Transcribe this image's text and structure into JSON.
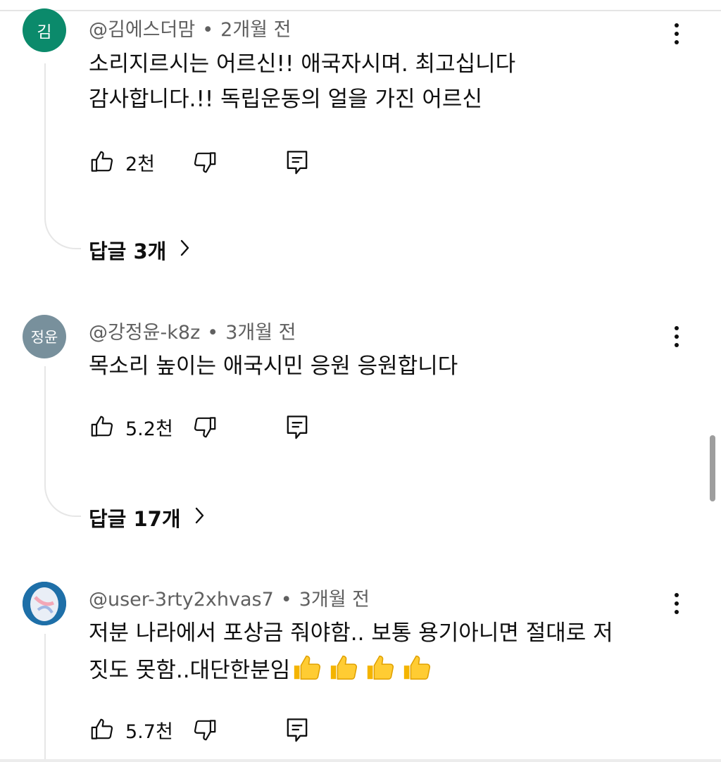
{
  "comments": [
    {
      "avatar_text": "김",
      "avatar_color": "#0b8a6b",
      "author": "@김에스더맘",
      "time": "2개월 전",
      "lines": [
        "소리지르시는 어르신!!   애국자시며. 최고십니다",
        "감사합니다.!!   독립운동의 얼을 가진 어르신"
      ],
      "likes": "2천",
      "replies_label": "답글 3개"
    },
    {
      "avatar_text": "정윤",
      "avatar_color": "#78909c",
      "author": "@강정윤-k8z",
      "time": "3개월 전",
      "lines": [
        "목소리 높이는 애국시민 응원 응원합니다"
      ],
      "likes": "5.2천",
      "replies_label": "답글 17개"
    },
    {
      "avatar_text": "",
      "avatar_color": "#1e6fa8",
      "author": "@user-3rty2xhvas7",
      "time": "3개월 전",
      "lines": [
        "저분 나라에서 포상금 줘야함.. 보통 용기아니면 절대로 저",
        "짓도 못함..대단한분임"
      ],
      "emoji": "thumbs-up-emoji x4",
      "likes": "5.7천"
    }
  ],
  "icons": {
    "like": "thumbs-up-icon",
    "dislike": "thumbs-down-icon",
    "reply": "comment-reply-icon",
    "menu": "more-vert-icon",
    "chevron": "chevron-right-icon"
  }
}
